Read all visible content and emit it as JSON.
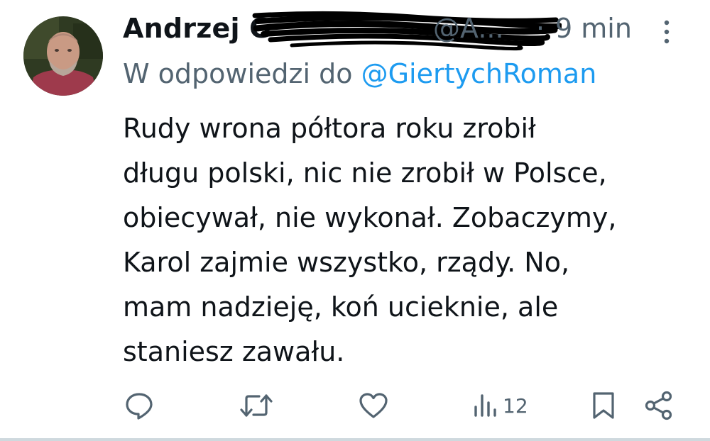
{
  "tweet": {
    "display_name": "Andrzej G",
    "handle": "@A...",
    "separator": "·",
    "time": "9 min",
    "reply_prefix": "W odpowiedzi do",
    "reply_to": "@GiertychRoman",
    "body_lines": [
      "Rudy wrona półtora roku zrobił",
      "długu polski, nic nie zrobił w Polsce,",
      "obiecywał, nie wykonał. Zobaczymy,",
      "Karol zajmie wszystko, rządy. No,",
      "mam nadzieję, koń ucieknie, ale",
      "staniesz zawału."
    ]
  },
  "actions": {
    "views_count": "12"
  },
  "icons": {
    "reply": "speech-bubble-icon",
    "retweet": "retweet-icon",
    "like": "heart-icon",
    "views": "bar-chart-icon",
    "bookmark": "bookmark-icon",
    "share": "share-icon",
    "more": "vertical-dots-icon"
  },
  "colors": {
    "text": "#0f1419",
    "secondary": "#536471",
    "link": "#1d9bf0",
    "icon": "#536471"
  }
}
